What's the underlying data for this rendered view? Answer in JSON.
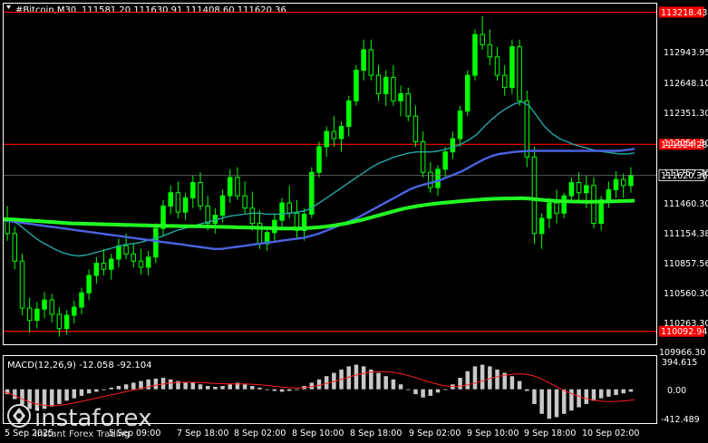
{
  "header": {
    "symbol": "#Bitcoin,M30",
    "ohlc": "111581.20 111630.91 111408.60 111620.36"
  },
  "colors": {
    "background": "#000000",
    "frame": "#ffffff",
    "candle": "#00ff00",
    "level_line": "#ff0000",
    "ma_fast": "#26a6a6",
    "ma_mid": "#4a63e0",
    "ma_slow": "#22ff22",
    "macd_hist": "#c8c8c8",
    "macd_signal": "#ff2020"
  },
  "price_axis": {
    "ticks": [
      "112943.95",
      "112648.10",
      "112351.30",
      "112054.30",
      "111757.76",
      "111460.30",
      "111154.38",
      "110857.56",
      "110560.30",
      "110263.30",
      "109966.30"
    ],
    "current_price": "111620.36"
  },
  "levels": [
    {
      "value": 113218.43,
      "label": "113218.43"
    },
    {
      "value": 111924.28,
      "label": "111924.28"
    },
    {
      "value": 110092.94,
      "label": "110092.94"
    }
  ],
  "macd": {
    "label": "MACD(12,26,9) -12.058 -92.104",
    "ticks": [
      "394.615",
      "0.00",
      "-412.489"
    ]
  },
  "time_axis": {
    "labels": [
      "5 Sep 2025",
      "5 Sep 09:00",
      "7 Sep 18:00",
      "8 Sep 02:00",
      "8 Sep 10:00",
      "8 Sep 18:00",
      "9 Sep 02:00",
      "9 Sep 10:00",
      "9 Sep 18:00",
      "10 Sep 02:00"
    ]
  },
  "watermark": {
    "brand": "instaforex",
    "tagline": "Instant Forex Trading"
  },
  "chart_data": {
    "type": "candlestick",
    "symbol": "#Bitcoin",
    "timeframe": "M30",
    "ylim": [
      109966.3,
      113302.0
    ],
    "ohlc": [
      [
        111200,
        111320,
        110980,
        111050
      ],
      [
        111050,
        111120,
        110700,
        110780
      ],
      [
        110780,
        110850,
        110250,
        110320
      ],
      [
        110320,
        110420,
        110080,
        110200
      ],
      [
        110200,
        110380,
        110120,
        110310
      ],
      [
        110310,
        110480,
        110220,
        110400
      ],
      [
        110400,
        110460,
        110180,
        110260
      ],
      [
        110260,
        110330,
        110040,
        110120
      ],
      [
        110120,
        110300,
        110060,
        110250
      ],
      [
        110250,
        110390,
        110170,
        110330
      ],
      [
        110330,
        110520,
        110260,
        110470
      ],
      [
        110470,
        110700,
        110400,
        110640
      ],
      [
        110640,
        110820,
        110560,
        110760
      ],
      [
        110760,
        110900,
        110640,
        110700
      ],
      [
        110700,
        110850,
        110600,
        110800
      ],
      [
        110800,
        111000,
        110720,
        110930
      ],
      [
        110930,
        111050,
        110800,
        110850
      ],
      [
        110850,
        110960,
        110720,
        110780
      ],
      [
        110780,
        110900,
        110650,
        110720
      ],
      [
        110720,
        110880,
        110640,
        110820
      ],
      [
        110820,
        111150,
        110760,
        111100
      ],
      [
        111100,
        111380,
        111020,
        111320
      ],
      [
        111320,
        111520,
        111240,
        111450
      ],
      [
        111450,
        111560,
        111200,
        111260
      ],
      [
        111260,
        111450,
        111180,
        111400
      ],
      [
        111400,
        111620,
        111300,
        111550
      ],
      [
        111550,
        111650,
        111280,
        111320
      ],
      [
        111320,
        111420,
        111080,
        111150
      ],
      [
        111150,
        111300,
        111050,
        111230
      ],
      [
        111230,
        111480,
        111160,
        111420
      ],
      [
        111420,
        111680,
        111350,
        111600
      ],
      [
        111600,
        111700,
        111380,
        111420
      ],
      [
        111420,
        111560,
        111250,
        111300
      ],
      [
        111300,
        111460,
        111080,
        111150
      ],
      [
        111150,
        111280,
        110900,
        110950
      ],
      [
        110950,
        111120,
        110880,
        111060
      ],
      [
        111060,
        111250,
        110980,
        111180
      ],
      [
        111180,
        111400,
        111100,
        111350
      ],
      [
        111350,
        111520,
        111200,
        111250
      ],
      [
        111250,
        111380,
        111000,
        111080
      ],
      [
        111080,
        111300,
        110980,
        111240
      ],
      [
        111240,
        111700,
        111200,
        111650
      ],
      [
        111650,
        111950,
        111600,
        111900
      ],
      [
        111900,
        112100,
        111800,
        112050
      ],
      [
        112050,
        112200,
        111900,
        111980
      ],
      [
        111980,
        112150,
        111850,
        112100
      ],
      [
        112100,
        112400,
        112000,
        112350
      ],
      [
        112350,
        112700,
        112300,
        112650
      ],
      [
        112650,
        112950,
        112550,
        112850
      ],
      [
        112850,
        112950,
        112550,
        112600
      ],
      [
        112600,
        112700,
        112350,
        112420
      ],
      [
        112420,
        112650,
        112300,
        112580
      ],
      [
        112580,
        112700,
        112300,
        112350
      ],
      [
        112350,
        112500,
        112200,
        112420
      ],
      [
        112420,
        112480,
        112150,
        112200
      ],
      [
        112200,
        112300,
        111900,
        111950
      ],
      [
        111950,
        112050,
        111600,
        111650
      ],
      [
        111650,
        111750,
        111450,
        111500
      ],
      [
        111500,
        111720,
        111420,
        111680
      ],
      [
        111680,
        111900,
        111600,
        111850
      ],
      [
        111850,
        112050,
        111780,
        111980
      ],
      [
        111980,
        112300,
        111900,
        112250
      ],
      [
        112250,
        112650,
        112200,
        112600
      ],
      [
        112600,
        113050,
        112550,
        113000
      ],
      [
        113000,
        113180,
        112850,
        112900
      ],
      [
        112900,
        113050,
        112700,
        112780
      ],
      [
        112780,
        112880,
        112550,
        112600
      ],
      [
        112600,
        112700,
        112400,
        112480
      ],
      [
        112480,
        112950,
        112420,
        112880
      ],
      [
        112880,
        112950,
        112300,
        112350
      ],
      [
        112350,
        112450,
        111700,
        111800
      ],
      [
        111800,
        111900,
        110950,
        111050
      ],
      [
        111050,
        111250,
        110900,
        111200
      ],
      [
        111200,
        111400,
        111100,
        111350
      ],
      [
        111350,
        111480,
        111150,
        111250
      ],
      [
        111250,
        111450,
        111200,
        111420
      ],
      [
        111420,
        111600,
        111350,
        111550
      ],
      [
        111550,
        111650,
        111380,
        111450
      ],
      [
        111450,
        111620,
        111300,
        111520
      ],
      [
        111520,
        111600,
        111100,
        111150
      ],
      [
        111150,
        111420,
        111080,
        111380
      ],
      [
        111380,
        111560,
        111300,
        111480
      ],
      [
        111480,
        111660,
        111400,
        111580
      ],
      [
        111580,
        111640,
        111400,
        111520
      ],
      [
        111520,
        111700,
        111450,
        111620
      ]
    ],
    "series": [
      {
        "values": [
          111200,
          111180,
          111140,
          111080,
          111020,
          110970,
          110930,
          110890,
          110860,
          110840,
          110830,
          110840,
          110860,
          110880,
          110900,
          110920,
          110940,
          110950,
          110960,
          110980,
          111000,
          111020,
          111050,
          111080,
          111100,
          111120,
          111140,
          111160,
          111180,
          111200,
          111220,
          111230,
          111240,
          111250,
          111250,
          111240,
          111240,
          111240,
          111250,
          111260,
          111270,
          111300,
          111350,
          111400,
          111450,
          111500,
          111550,
          111600,
          111650,
          111700,
          111740,
          111770,
          111800,
          111820,
          111840,
          111850,
          111850,
          111850,
          111860,
          111880,
          111900,
          111930,
          111970,
          112020,
          112100,
          112170,
          112230,
          112280,
          112320,
          112340,
          112300,
          112200,
          112100,
          112030,
          111980,
          111950,
          111920,
          111900,
          111880,
          111860,
          111850,
          111840,
          111830,
          111830,
          111840
        ]
      },
      {
        "values": [
          111180,
          111170,
          111160,
          111150,
          111140,
          111130,
          111120,
          111110,
          111100,
          111090,
          111080,
          111070,
          111060,
          111050,
          111040,
          111030,
          111020,
          111010,
          111000,
          110990,
          110980,
          110970,
          110960,
          110950,
          110940,
          110930,
          110920,
          110910,
          110900,
          110900,
          110910,
          110920,
          110930,
          110940,
          110950,
          110960,
          110970,
          110980,
          110990,
          111000,
          111010,
          111030,
          111050,
          111080,
          111110,
          111140,
          111170,
          111200,
          111240,
          111280,
          111320,
          111360,
          111400,
          111440,
          111480,
          111510,
          111530,
          111550,
          111570,
          111600,
          111630,
          111660,
          111700,
          111740,
          111780,
          111810,
          111830,
          111840,
          111850,
          111855,
          111860,
          111860,
          111860,
          111860,
          111860,
          111860,
          111860,
          111860,
          111860,
          111860,
          111860,
          111860,
          111860,
          111870,
          111880
        ]
      },
      {
        "values": [
          111190,
          111190,
          111185,
          111180,
          111175,
          111170,
          111165,
          111160,
          111155,
          111150,
          111148,
          111146,
          111144,
          111142,
          111140,
          111138,
          111136,
          111134,
          111132,
          111130,
          111128,
          111126,
          111125,
          111124,
          111123,
          111122,
          111121,
          111120,
          111118,
          111116,
          111114,
          111112,
          111110,
          111108,
          111106,
          111104,
          111102,
          111100,
          111100,
          111100,
          111102,
          111106,
          111112,
          111120,
          111130,
          111142,
          111156,
          111172,
          111190,
          111210,
          111230,
          111250,
          111270,
          111290,
          111305,
          111318,
          111330,
          111340,
          111348,
          111355,
          111362,
          111368,
          111374,
          111380,
          111386,
          111390,
          111392,
          111394,
          111395,
          111396,
          111392,
          111385,
          111378,
          111372,
          111368,
          111366,
          111364,
          111363,
          111362,
          111363,
          111364,
          111366,
          111368,
          111370,
          111372
        ]
      }
    ],
    "hlines": [
      113218.43,
      111924.28,
      110092.94
    ],
    "macd": {
      "name": "MACD(12,26,9)",
      "value": -12.058,
      "signal_value": -92.104,
      "ylim": [
        -412.489,
        394.615
      ],
      "histogram": [
        -60,
        -120,
        -190,
        -240,
        -260,
        -240,
        -210,
        -180,
        -140,
        -110,
        -80,
        -50,
        -30,
        -10,
        20,
        40,
        60,
        80,
        100,
        120,
        130,
        140,
        120,
        100,
        90,
        80,
        60,
        40,
        30,
        40,
        60,
        80,
        60,
        40,
        20,
        0,
        -20,
        -30,
        -20,
        0,
        40,
        80,
        120,
        160,
        200,
        240,
        280,
        300,
        280,
        240,
        200,
        160,
        120,
        60,
        0,
        -60,
        -100,
        -80,
        -40,
        0,
        60,
        140,
        220,
        280,
        300,
        280,
        240,
        200,
        160,
        100,
        -20,
        -180,
        -300,
        -360,
        -340,
        -300,
        -260,
        -220,
        -180,
        -140,
        -110,
        -90,
        -70,
        -50,
        -30
      ],
      "signal": [
        -30,
        -60,
        -100,
        -140,
        -170,
        -190,
        -200,
        -200,
        -190,
        -175,
        -155,
        -135,
        -115,
        -95,
        -75,
        -55,
        -35,
        -15,
        5,
        25,
        45,
        62,
        75,
        82,
        85,
        85,
        83,
        78,
        72,
        68,
        66,
        66,
        65,
        62,
        56,
        48,
        38,
        28,
        20,
        16,
        20,
        32,
        50,
        72,
        96,
        122,
        150,
        175,
        196,
        210,
        216,
        214,
        204,
        188,
        165,
        138,
        108,
        80,
        56,
        40,
        34,
        40,
        58,
        82,
        110,
        138,
        160,
        176,
        186,
        188,
        178,
        150,
        108,
        60,
        12,
        -30,
        -68,
        -100,
        -124,
        -140,
        -148,
        -150,
        -146,
        -138,
        -126
      ]
    }
  }
}
